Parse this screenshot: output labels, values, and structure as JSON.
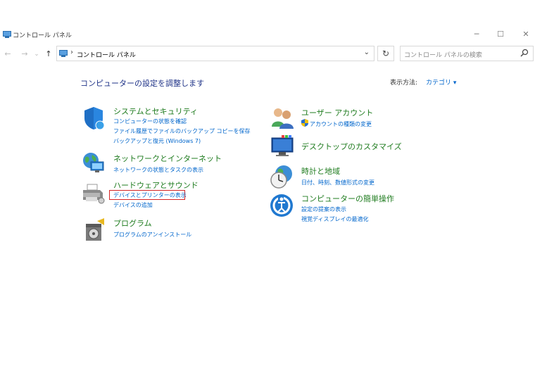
{
  "window": {
    "title": "コントロール パネル",
    "controls": {
      "minimize": "─",
      "maximize": "☐",
      "close": "✕"
    }
  },
  "nav": {
    "back": "←",
    "forward": "→",
    "recent": "⌄",
    "up": "↑",
    "address_separator": "›",
    "address": "コントロール パネル",
    "address_dropdown": "⌄",
    "refresh": "↻",
    "search_placeholder": "コントロール パネルの検索"
  },
  "main": {
    "title": "コンピューターの設定を調整します",
    "view_by_label": "表示方法:",
    "view_by_value": "カテゴリ ▾"
  },
  "categories_left": [
    {
      "icon": "shield-icon",
      "title": "システムとセキュリティ",
      "links": [
        "コンピューターの状態を確認",
        "ファイル履歴でファイルのバックアップ コピーを保存",
        "バックアップと復元 (Windows 7)"
      ]
    },
    {
      "icon": "network-icon",
      "title": "ネットワークとインターネット",
      "links": [
        "ネットワークの状態とタスクの表示"
      ]
    },
    {
      "icon": "printer-icon",
      "title": "ハードウェアとサウンド",
      "links": [
        "デバイスとプリンターの表示",
        "デバイスの追加"
      ]
    },
    {
      "icon": "programs-icon",
      "title": "プログラム",
      "links": [
        "プログラムのアンインストール"
      ]
    }
  ],
  "categories_right": [
    {
      "icon": "users-icon",
      "title": "ユーザー アカウント",
      "links": [
        "アカウントの種類の変更"
      ]
    },
    {
      "icon": "desktop-icon",
      "title": "デスクトップのカスタマイズ",
      "links": []
    },
    {
      "icon": "clock-globe-icon",
      "title": "時計と地域",
      "links": [
        "日付、時刻、数値形式の変更"
      ]
    },
    {
      "icon": "ease-of-access-icon",
      "title": "コンピューターの簡単操作",
      "links": [
        "設定の提案の表示",
        "視覚ディスプレイの最適化"
      ]
    }
  ],
  "colors": {
    "category_title": "#1e7b1e",
    "link": "#0066cc",
    "heading": "#1e3287",
    "highlight": "#d42424"
  }
}
